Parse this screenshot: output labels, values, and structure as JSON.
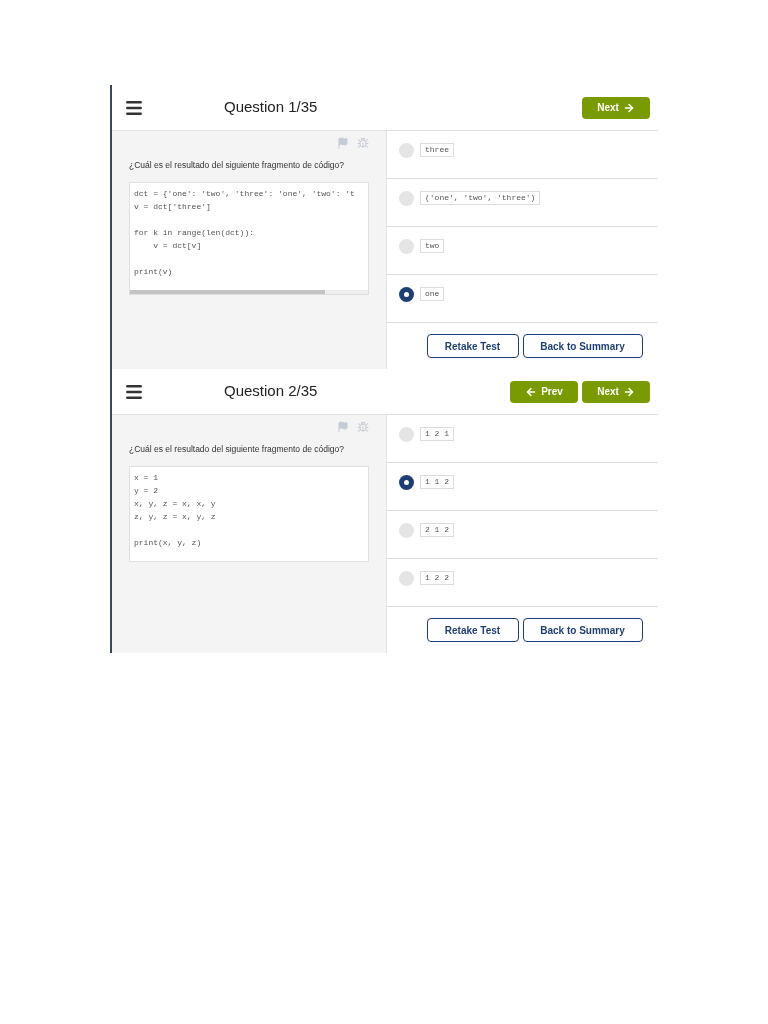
{
  "quizzes": [
    {
      "title": "Question 1/35",
      "nav_buttons": [
        {
          "kind": "next",
          "label": "Next"
        }
      ],
      "prompt": "¿Cuál es el resultado del siguiente fragmento de código?",
      "code": "dct = {'one': 'two', 'three': 'one', 'two': 't\nv = dct['three']\n\nfor k in range(len(dct)):\n    v = dct[v]\n\nprint(v)",
      "code_scrollbar": true,
      "options": [
        {
          "label": "three",
          "selected": false
        },
        {
          "label": "('one', 'two', 'three')",
          "selected": false
        },
        {
          "label": "two",
          "selected": false
        },
        {
          "label": "one",
          "selected": true
        }
      ],
      "actions": [
        "Retake Test",
        "Back to Summary"
      ]
    },
    {
      "title": "Question 2/35",
      "nav_buttons": [
        {
          "kind": "prev",
          "label": "Prev"
        },
        {
          "kind": "next",
          "label": "Next"
        }
      ],
      "prompt": "¿Cuál es el resultado del siguiente fragmento de código?",
      "code": "x = 1\ny = 2\nx, y, z = x, x, y\nz, y, z = x, y, z\n\nprint(x, y, z)",
      "code_scrollbar": false,
      "options": [
        {
          "label": "1 2 1",
          "selected": false
        },
        {
          "label": "1 1 2",
          "selected": true
        },
        {
          "label": "2 1 2",
          "selected": false
        },
        {
          "label": "1 2 2",
          "selected": false
        }
      ],
      "actions": [
        "Retake Test",
        "Back to Summary"
      ]
    }
  ]
}
